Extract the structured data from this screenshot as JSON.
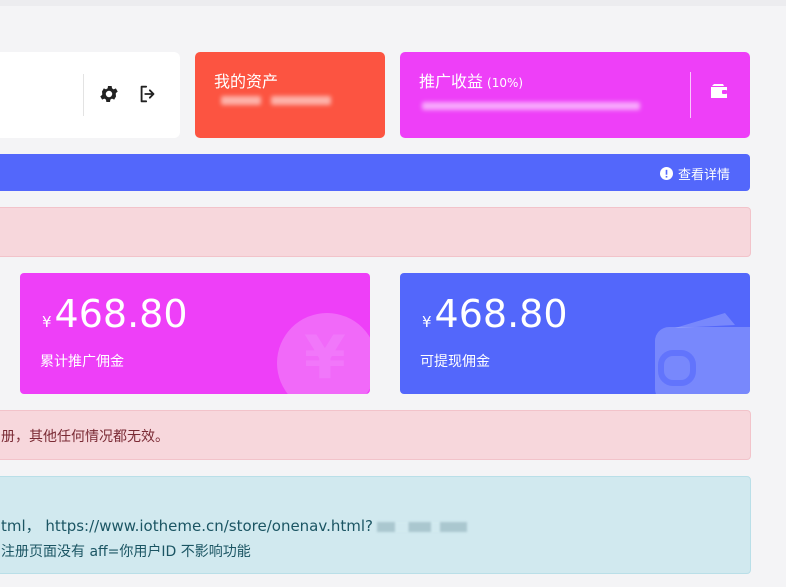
{
  "header_card": {
    "settings_icon": "gear-icon",
    "logout_icon": "logout-icon"
  },
  "asset_card": {
    "title": "我的资产",
    "bg_color": "#fc5441"
  },
  "promo_card": {
    "title": "推广收益",
    "rate": "(10%)",
    "icon": "wallet-icon",
    "bg_color": "#ee3ff8"
  },
  "notice_bar": {
    "detail_label": "查看详情",
    "detail_icon": "exclamation-circle-icon",
    "bg_color": "#5367fb"
  },
  "stats": {
    "total_commission": {
      "currency": "¥",
      "amount": "468.80",
      "label": "累计推广佣金",
      "icon": "yen-icon"
    },
    "withdrawable_commission": {
      "currency": "¥",
      "amount": "468.80",
      "label": "可提现佣金",
      "icon": "wallet-icon"
    }
  },
  "warning": {
    "text": "册，其他任何情况都无效。"
  },
  "info_box": {
    "line1": "tml， https://www.iotheme.cn/store/onenav.html?",
    "line2": "注册页面没有 aff=你用户ID 不影响功能"
  }
}
